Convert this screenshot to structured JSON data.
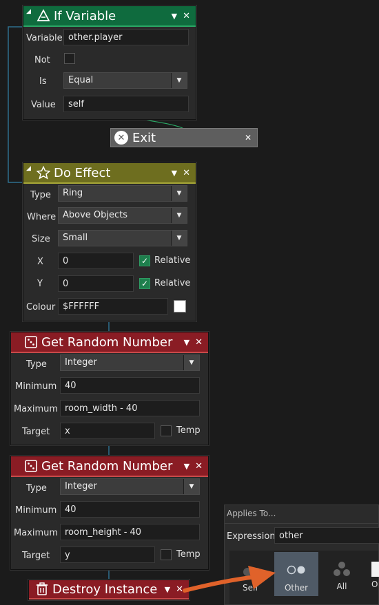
{
  "if_variable": {
    "title": "If Variable",
    "variable_label": "Variable",
    "variable_value": "other.player",
    "not_label": "Not",
    "is_label": "Is",
    "is_value": "Equal",
    "value_label": "Value",
    "value_value": "self"
  },
  "exit": {
    "title": "Exit"
  },
  "do_effect": {
    "title": "Do Effect",
    "type_label": "Type",
    "type_value": "Ring",
    "where_label": "Where",
    "where_value": "Above Objects",
    "size_label": "Size",
    "size_value": "Small",
    "x_label": "X",
    "x_value": "0",
    "x_relative": "Relative",
    "y_label": "Y",
    "y_value": "0",
    "y_relative": "Relative",
    "colour_label": "Colour",
    "colour_value": "$FFFFFF"
  },
  "random1": {
    "title": "Get Random Number",
    "type_label": "Type",
    "type_value": "Integer",
    "min_label": "Minimum",
    "min_value": "40",
    "max_label": "Maximum",
    "max_value": "room_width - 40",
    "target_label": "Target",
    "target_value": "x",
    "temp_label": "Temp"
  },
  "random2": {
    "title": "Get Random Number",
    "type_label": "Type",
    "type_value": "Integer",
    "min_label": "Minimum",
    "min_value": "40",
    "max_label": "Maximum",
    "max_value": "room_height - 40",
    "target_label": "Target",
    "target_value": "y",
    "temp_label": "Temp"
  },
  "destroy": {
    "title": "Destroy Instance"
  },
  "applies_to": {
    "title": "Applies To...",
    "expression_label": "Expression",
    "expression_value": "other",
    "options": [
      "Self",
      "Other",
      "All",
      "O"
    ]
  },
  "colors": {
    "green": "#0f6b3e",
    "olive": "#6e6e1f",
    "red": "#8a1c24",
    "arrow": "#e0622a",
    "connector": "#2e6f8e"
  }
}
